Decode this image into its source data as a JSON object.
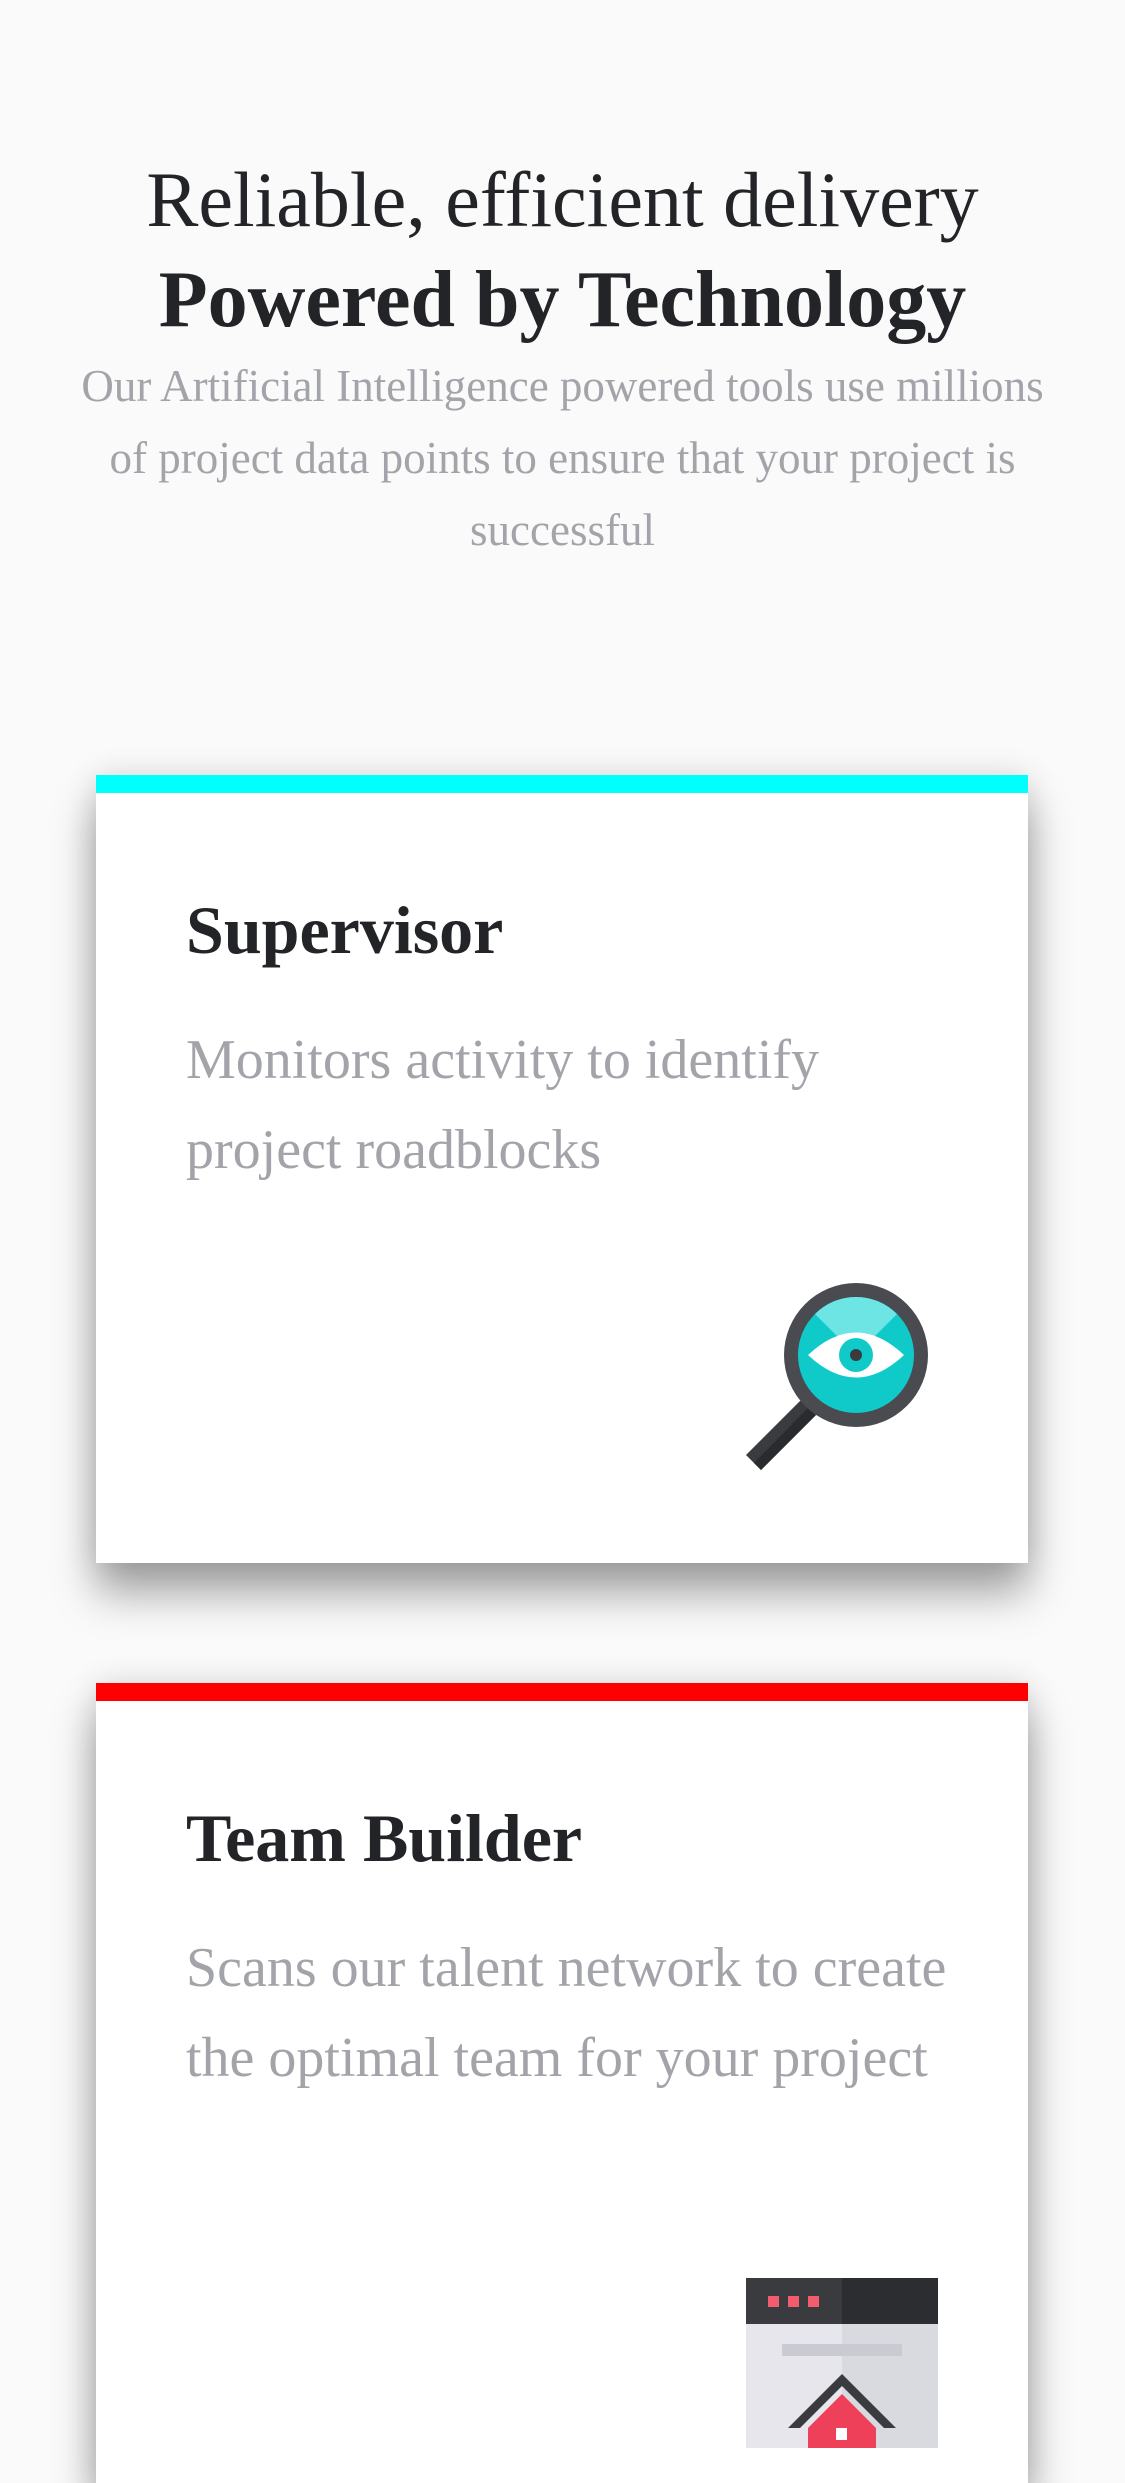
{
  "hero": {
    "title_line1": "Reliable, efficient delivery",
    "title_line2": "Powered by Technology",
    "subtitle": "Our Artificial Intelligence powered tools use millions of project data points to ensure that your project is successful"
  },
  "cards": [
    {
      "title": "Supervisor",
      "description": "Monitors activity to identify project roadblocks",
      "accent_color": "#00ffff",
      "icon": "magnifier-eye-icon"
    },
    {
      "title": "Team Builder",
      "description": "Scans our talent network to create the optimal team for your project",
      "accent_color": "#ff0000",
      "icon": "browser-home-icon"
    }
  ]
}
